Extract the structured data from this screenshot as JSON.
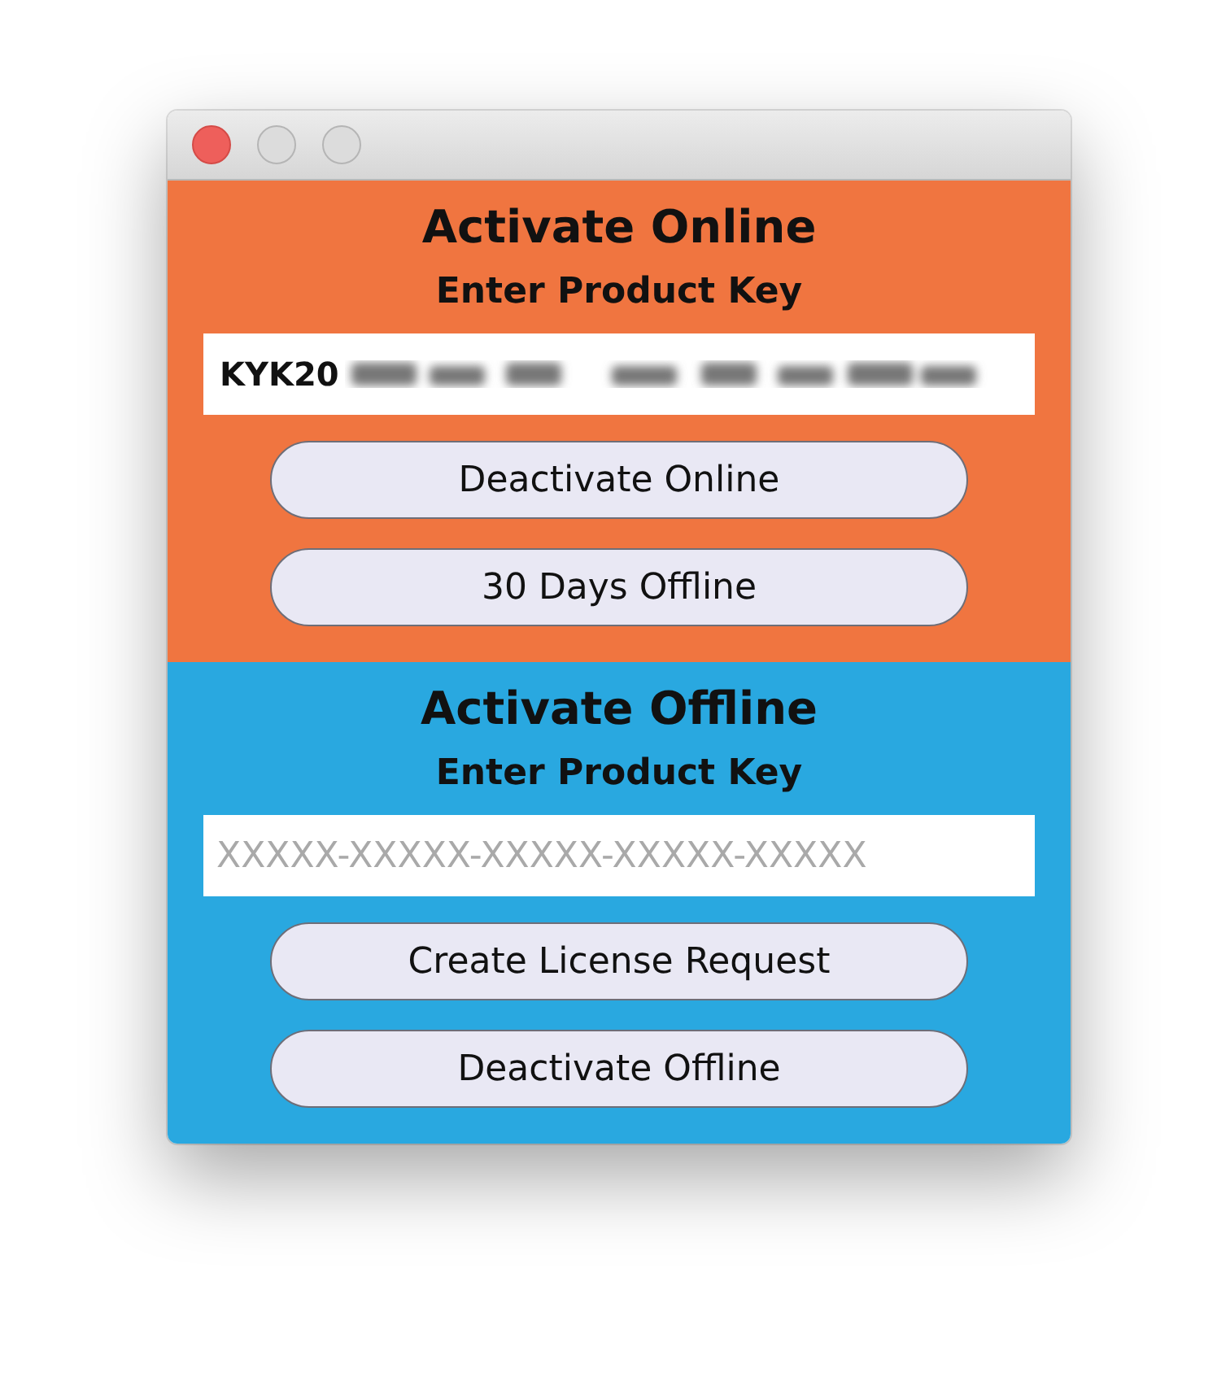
{
  "window": {
    "controls": [
      {
        "kind": "close"
      },
      {
        "kind": "minimize"
      },
      {
        "kind": "zoom"
      }
    ]
  },
  "sections": [
    {
      "title": "Activate Online",
      "color": "#f07540",
      "label": "Enter Product Key",
      "field": {
        "value": "KYK20",
        "redacted": true
      },
      "buttons": [
        "Deactivate Online",
        "30 Days Offline"
      ]
    },
    {
      "title": "Activate Offline",
      "color": "#29a8e0",
      "label": "Enter Product Key",
      "field": {
        "placeholder": "XXXXX-XXXXX-XXXXX-XXXXX-XXXXX"
      },
      "buttons": [
        "Create License Request",
        "Deactivate Offline"
      ]
    }
  ]
}
